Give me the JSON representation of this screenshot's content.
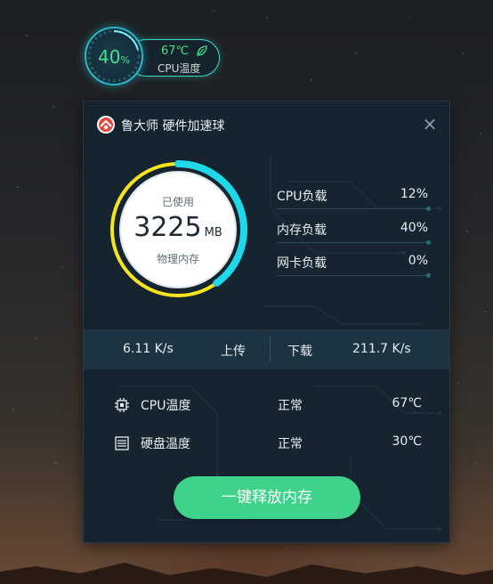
{
  "float_ball": {
    "memory_percent": "40",
    "percent_sign": "%",
    "cpu_temp": "67℃",
    "cpu_temp_label": "CPU温度",
    "icon": "leaf-icon"
  },
  "panel": {
    "title": "鲁大师 硬件加速球",
    "logo_icon": "ludashi-logo-icon",
    "close_label": "×",
    "memory": {
      "top_label": "已使用",
      "value": "3225",
      "unit": "MB",
      "bottom_label": "物理内存",
      "usage_fraction": 0.4
    },
    "loads": [
      {
        "name": "CPU负载",
        "value": "12%"
      },
      {
        "name": "内存负载",
        "value": "40%"
      },
      {
        "name": "网卡负载",
        "value": "0%"
      }
    ],
    "network": {
      "upload_value": "6.11 K/s",
      "upload_label": "上传",
      "download_label": "下载",
      "download_value": "211.7 K/s"
    },
    "temps": [
      {
        "icon": "cpu-chip-icon",
        "name": "CPU温度",
        "status": "正常",
        "value": "67℃"
      },
      {
        "icon": "hard-disk-icon",
        "name": "硬盘温度",
        "status": "正常",
        "value": "30℃"
      }
    ],
    "release_button": "一键释放内存"
  },
  "colors": {
    "accent_green": "#3fd28a",
    "ring_cyan": "#1fd8e8",
    "ring_yellow": "#f4e51c",
    "panel_bg": "#15242f"
  }
}
